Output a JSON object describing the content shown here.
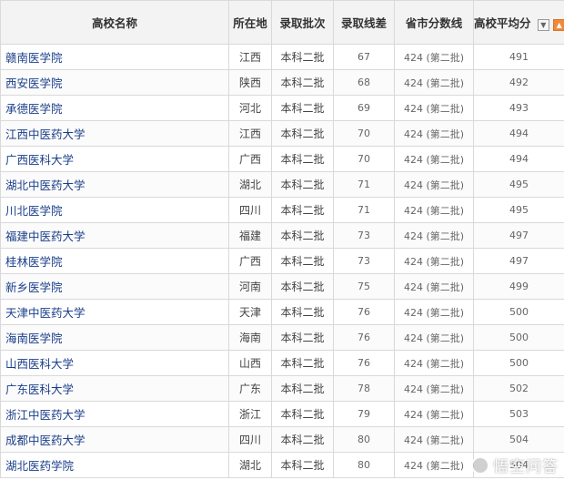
{
  "table": {
    "headers": {
      "name": "高校名称",
      "location": "所在地",
      "batch": "录取批次",
      "diff": "录取线差",
      "province_line": "省市分数线",
      "avg": "高校平均分"
    },
    "sort_icons": [
      "sort-down-icon",
      "sort-up-icon"
    ],
    "rows": [
      {
        "name": "赣南医学院",
        "location": "江西",
        "batch": "本科二批",
        "diff": "67",
        "province_line": "424 (第二批)",
        "avg": "491"
      },
      {
        "name": "西安医学院",
        "location": "陕西",
        "batch": "本科二批",
        "diff": "68",
        "province_line": "424 (第二批)",
        "avg": "492"
      },
      {
        "name": "承德医学院",
        "location": "河北",
        "batch": "本科二批",
        "diff": "69",
        "province_line": "424 (第二批)",
        "avg": "493"
      },
      {
        "name": "江西中医药大学",
        "location": "江西",
        "batch": "本科二批",
        "diff": "70",
        "province_line": "424 (第二批)",
        "avg": "494"
      },
      {
        "name": "广西医科大学",
        "location": "广西",
        "batch": "本科二批",
        "diff": "70",
        "province_line": "424 (第二批)",
        "avg": "494"
      },
      {
        "name": "湖北中医药大学",
        "location": "湖北",
        "batch": "本科二批",
        "diff": "71",
        "province_line": "424 (第二批)",
        "avg": "495"
      },
      {
        "name": "川北医学院",
        "location": "四川",
        "batch": "本科二批",
        "diff": "71",
        "province_line": "424 (第二批)",
        "avg": "495"
      },
      {
        "name": "福建中医药大学",
        "location": "福建",
        "batch": "本科二批",
        "diff": "73",
        "province_line": "424 (第二批)",
        "avg": "497"
      },
      {
        "name": "桂林医学院",
        "location": "广西",
        "batch": "本科二批",
        "diff": "73",
        "province_line": "424 (第二批)",
        "avg": "497"
      },
      {
        "name": "新乡医学院",
        "location": "河南",
        "batch": "本科二批",
        "diff": "75",
        "province_line": "424 (第二批)",
        "avg": "499"
      },
      {
        "name": "天津中医药大学",
        "location": "天津",
        "batch": "本科二批",
        "diff": "76",
        "province_line": "424 (第二批)",
        "avg": "500"
      },
      {
        "name": "海南医学院",
        "location": "海南",
        "batch": "本科二批",
        "diff": "76",
        "province_line": "424 (第二批)",
        "avg": "500"
      },
      {
        "name": "山西医科大学",
        "location": "山西",
        "batch": "本科二批",
        "diff": "76",
        "province_line": "424 (第二批)",
        "avg": "500"
      },
      {
        "name": "广东医科大学",
        "location": "广东",
        "batch": "本科二批",
        "diff": "78",
        "province_line": "424 (第二批)",
        "avg": "502"
      },
      {
        "name": "浙江中医药大学",
        "location": "浙江",
        "batch": "本科二批",
        "diff": "79",
        "province_line": "424 (第二批)",
        "avg": "503"
      },
      {
        "name": "成都中医药大学",
        "location": "四川",
        "batch": "本科二批",
        "diff": "80",
        "province_line": "424 (第二批)",
        "avg": "504"
      },
      {
        "name": "湖北医药学院",
        "location": "湖北",
        "batch": "本科二批",
        "diff": "80",
        "province_line": "424 (第二批)",
        "avg": "504"
      }
    ]
  },
  "watermark": {
    "text": "悟空问答",
    "icon": "wukong-logo-icon"
  },
  "colors": {
    "link": "#1a3f8a",
    "header_bg": "#f3f3f3",
    "border": "#d9d9d9",
    "sort_active": "#f08a3a"
  }
}
